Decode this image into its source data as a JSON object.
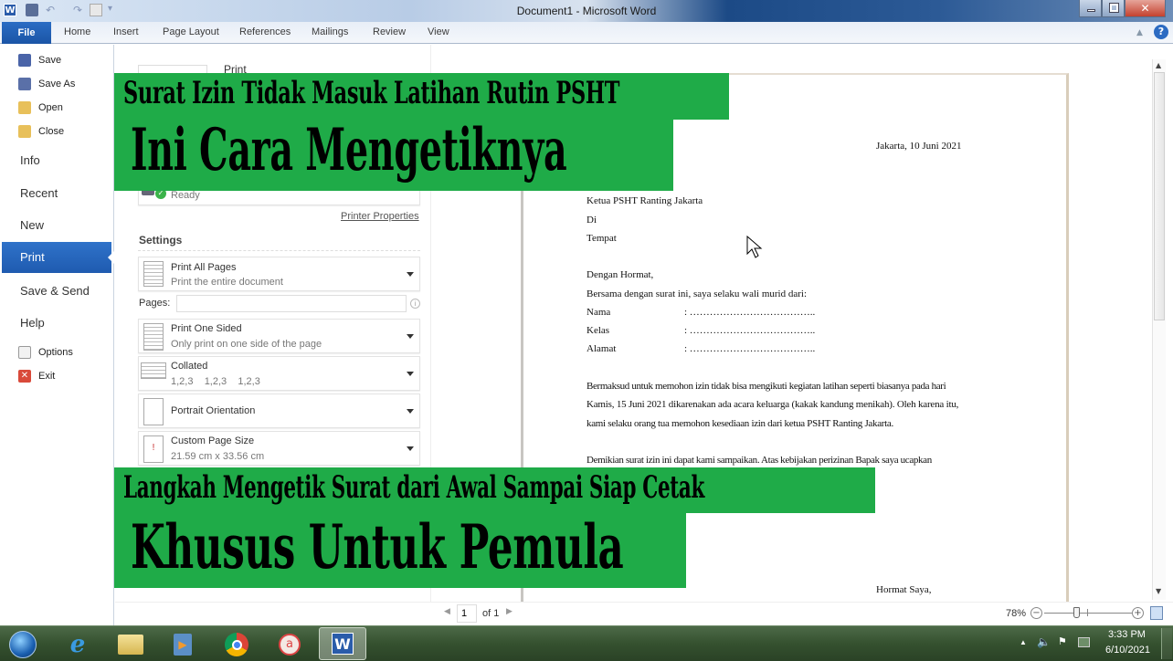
{
  "window": {
    "title": "Document1 - Microsoft Word",
    "quick_access": [
      "word-logo-icon",
      "save-icon",
      "undo-icon",
      "redo-icon",
      "print-preview-icon",
      "customize-icon"
    ],
    "controls": [
      "minimize",
      "restore",
      "close"
    ]
  },
  "ribbon": {
    "file_label": "File",
    "tabs": [
      "Home",
      "Insert",
      "Page Layout",
      "References",
      "Mailings",
      "Review",
      "View"
    ]
  },
  "backstage_nav": {
    "small_items": [
      {
        "label": "Save",
        "icon": "save-icon"
      },
      {
        "label": "Save As",
        "icon": "save-as-icon"
      },
      {
        "label": "Open",
        "icon": "open-folder-icon"
      },
      {
        "label": "Close",
        "icon": "close-folder-icon"
      }
    ],
    "big_items": [
      "Info",
      "Recent",
      "New",
      "Print",
      "Save & Send",
      "Help"
    ],
    "selected": "Print",
    "bottom_items": [
      {
        "label": "Options",
        "icon": "options-icon"
      },
      {
        "label": "Exit",
        "icon": "exit-icon"
      }
    ]
  },
  "print_panel": {
    "heading": "Print",
    "printer_status": "Ready",
    "printer_properties_link": "Printer Properties",
    "settings_heading": "Settings",
    "pages_label": "Pages:",
    "pages_value": "",
    "options": [
      {
        "title": "Print All Pages",
        "subtitle": "Print the entire document"
      },
      {
        "title": "Print One Sided",
        "subtitle": "Only print on one side of the page"
      },
      {
        "title": "Collated",
        "subtitle": "1,2,3    1,2,3    1,2,3"
      },
      {
        "title": "Portrait Orientation",
        "subtitle": ""
      },
      {
        "title": "Custom Page Size",
        "subtitle": "21.59 cm x 33.56 cm"
      }
    ]
  },
  "document": {
    "date_line": "Jakarta, 10 Juni 2021",
    "recipient": [
      "Ketua PSHT Ranting Jakarta",
      "Di",
      "Tempat"
    ],
    "greeting": "Dengan Hormat,",
    "intro": "Bersama dengan surat ini, saya selaku wali murid dari:",
    "fields": [
      {
        "label": "Nama",
        "value": ": ……………………………….."
      },
      {
        "label": "Kelas",
        "value": ": ……………………………….."
      },
      {
        "label": "Alamat",
        "value": ": ……………………………….."
      }
    ],
    "body_lines": [
      "Bermaksud untuk memohon izin tidak bisa mengikuti kegiatan latihan seperti biasanya pada hari",
      "Kamis, 15 Juni 2021 dikarenakan ada acara keluarga (kakak kandung menikah). Oleh karena itu,",
      "kami selaku orang tua memohon kesediaan izin dari ketua PSHT Ranting Jakarta."
    ],
    "closing_line": "Demikian surat izin ini dapat kami sampaikan. Atas kebijakan perizinan Bapak saya ucapkan",
    "signoff": "Hormat Saya,"
  },
  "page_nav": {
    "current_page": "1",
    "of_label": "of 1"
  },
  "zoom": {
    "level_label": "78%",
    "level_percent": 78
  },
  "overlays": {
    "line1": "Surat Izin Tidak Masuk Latihan Rutin PSHT",
    "line2": "Ini Cara Mengetiknya",
    "line3": "Langkah Mengetik Surat dari Awal Sampai Siap Cetak",
    "line4": "Khusus Untuk Pemula",
    "color": "#1fab48"
  },
  "taskbar": {
    "apps": [
      "start-orb-icon",
      "internet-explorer-icon",
      "file-explorer-icon",
      "media-player-icon",
      "chrome-icon",
      "app-red-circle-icon",
      "word-icon"
    ],
    "active_app": "word-icon",
    "tray_icons": [
      "show-hidden-icons",
      "volume-icon",
      "action-center-flag-icon",
      "network-icon"
    ],
    "time": "3:33 PM",
    "date": "6/10/2021"
  }
}
